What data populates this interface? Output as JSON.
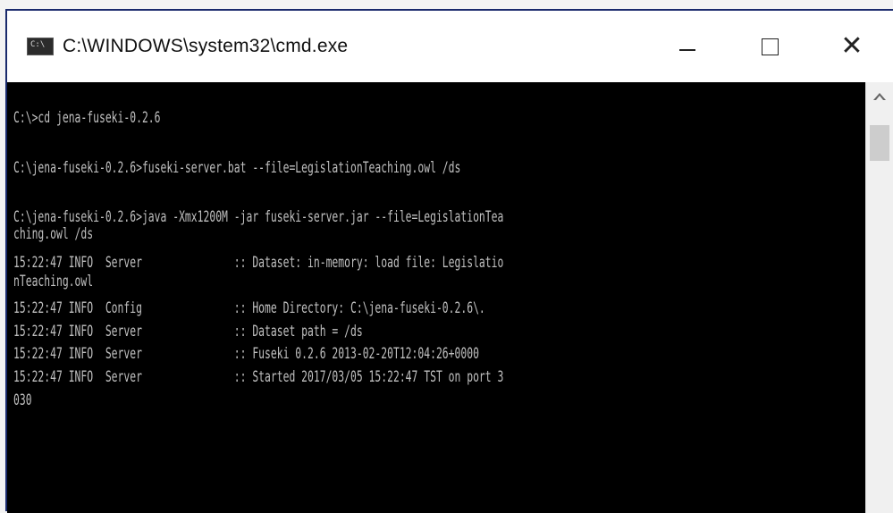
{
  "window": {
    "title": "C:\\WINDOWS\\system32\\cmd.exe",
    "icon_text": "C:\\",
    "icon": "cmd-icon",
    "controls": {
      "minimize_icon": "minimize-icon",
      "maximize_icon": "maximize-icon",
      "close_icon": "close-icon",
      "close_glyph": "✕"
    }
  },
  "console": {
    "lines": [
      "C:\\>cd jena-fuseki-0.2.6",
      "",
      "C:\\jena-fuseki-0.2.6>fuseki-server.bat --file=LegislationTeaching.owl /ds",
      "",
      "C:\\jena-fuseki-0.2.6>java -Xmx1200M -jar fuseki-server.jar --file=LegislationTea",
      "ching.owl /ds",
      "15:22:47 INFO  Server               :: Dataset: in-memory: load file: Legislatio",
      "nTeaching.owl",
      "15:22:47 INFO  Config               :: Home Directory: C:\\jena-fuseki-0.2.6\\.",
      "15:22:47 INFO  Server               :: Dataset path = /ds",
      "15:22:47 INFO  Server               :: Fuseki 0.2.6 2013-02-20T12:04:26+0000",
      "15:22:47 INFO  Server               :: Started 2017/03/05 15:22:47 TST on port 3",
      "030"
    ]
  },
  "colors": {
    "console_bg": "#000000",
    "console_text": "#c0c0c0",
    "titlebar_bg": "#ffffff"
  }
}
